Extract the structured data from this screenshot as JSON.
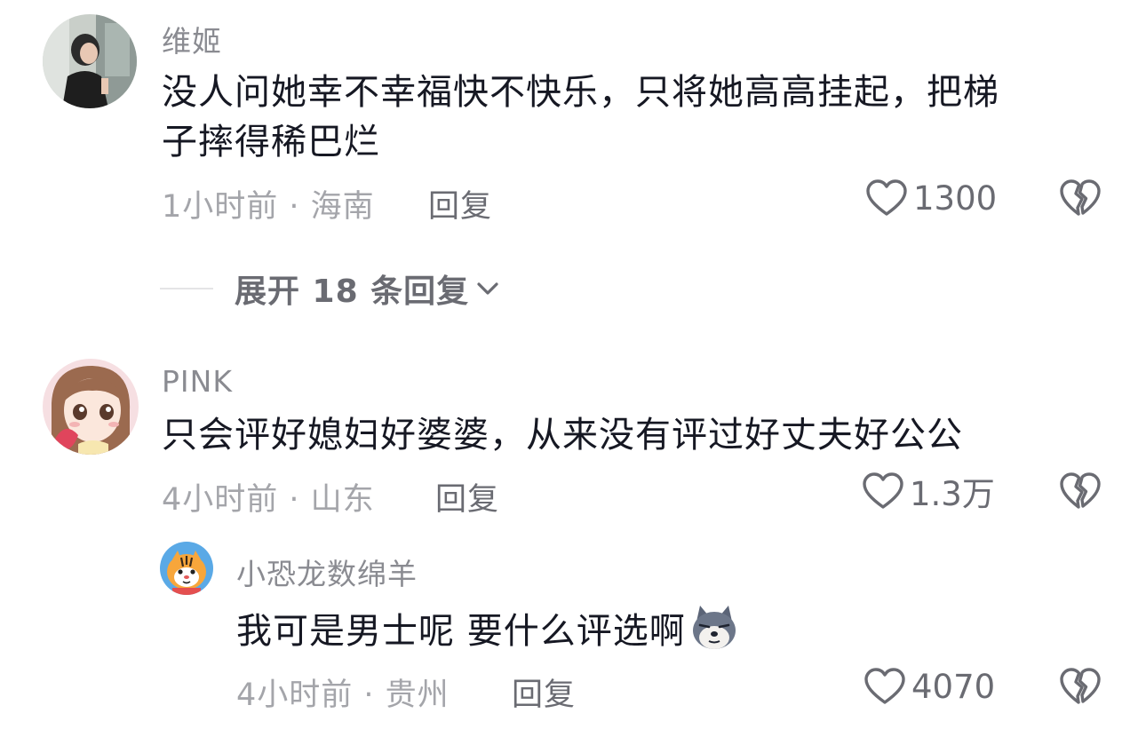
{
  "comments": [
    {
      "username": "维姬",
      "content_line1": "没人问她幸不幸福快不快乐，只将她高高挂起，把梯",
      "content_line2": "子摔得稀巴烂",
      "meta": "1小时前 · 海南",
      "reply_label": "回复",
      "like_count": "1300"
    },
    {
      "username": "PINK",
      "content_line1": "只会评好媳妇好婆婆，从来没有评过好丈夫好公公",
      "meta": "4小时前 · 山东",
      "reply_label": "回复",
      "like_count": "1.3万"
    }
  ],
  "expand_replies_label": "展开 18 条回复",
  "sub_reply": {
    "username": "小恐龙数绵羊",
    "content": "我可是男士呢 要什么评选啊",
    "emoji": "wolf-emoji",
    "meta": "4小时前 · 贵州",
    "reply_label": "回复",
    "like_count": "4070"
  },
  "icons": {
    "like": "heart-outline-icon",
    "dislike": "broken-heart-icon",
    "expand": "chevron-down-icon"
  },
  "colors": {
    "text_primary": "#161823",
    "text_secondary": "#8a8b91",
    "text_action": "#6a6b72"
  }
}
